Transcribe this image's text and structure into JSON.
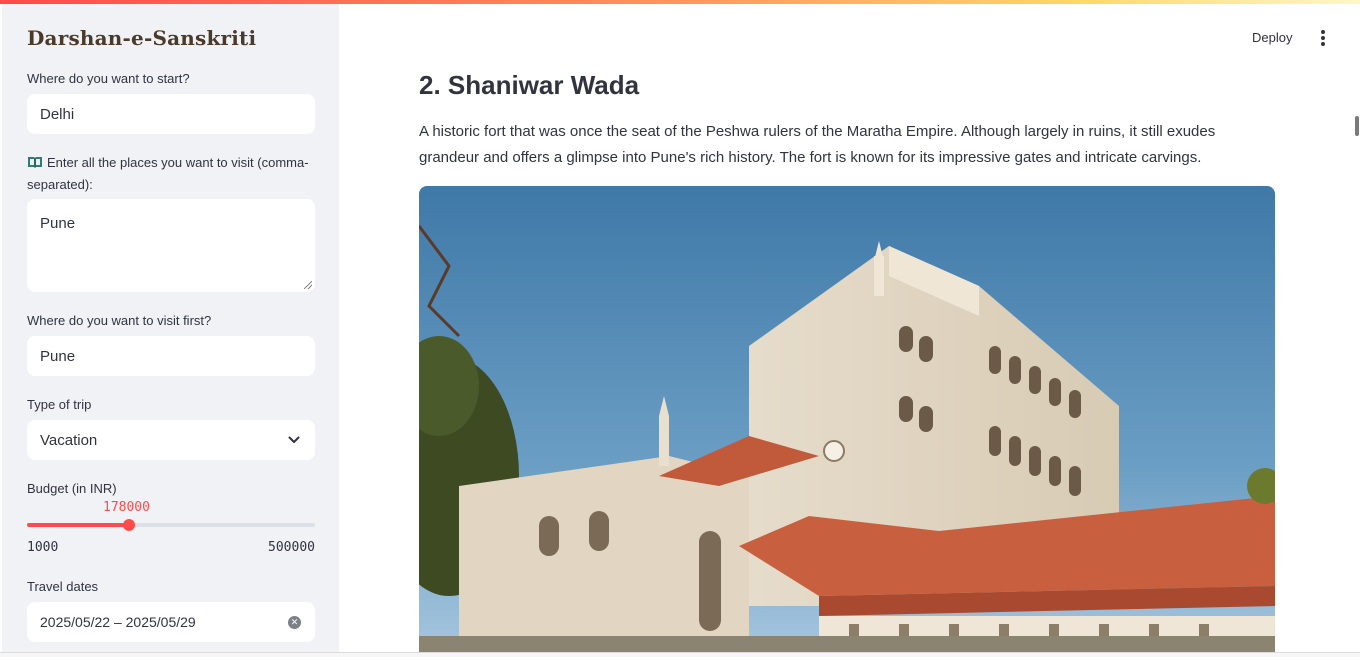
{
  "app": {
    "title": "Darshan-e-Sanskriti"
  },
  "header": {
    "deploy_label": "Deploy"
  },
  "sidebar": {
    "start": {
      "label": "Where do you want to start?",
      "value": "Delhi"
    },
    "places": {
      "icon": "open-book-icon",
      "label": "Enter all the places you want to visit (comma-separated):",
      "value": "Pune"
    },
    "first": {
      "label": "Where do you want to visit first?",
      "value": "Pune"
    },
    "trip_type": {
      "label": "Type of trip",
      "value": "Vacation"
    },
    "budget": {
      "label": "Budget (in INR)",
      "value": 178000,
      "value_text": "178000",
      "min": 1000,
      "min_text": "1000",
      "max": 500000,
      "max_text": "500000"
    },
    "dates": {
      "label": "Travel dates",
      "value": "2025/05/22 – 2025/05/29"
    }
  },
  "main": {
    "heading": "2. Shaniwar Wada",
    "description": "A historic fort that was once the seat of the Peshwa rulers of the Maratha Empire. Although largely in ruins, it still exudes grandeur and offers a glimpse into Pune's rich history. The fort is known for its impressive gates and intricate carvings."
  },
  "colors": {
    "accent": "#ff4b4b",
    "sidebar_bg": "#f0f2f6",
    "text": "#31333f"
  }
}
